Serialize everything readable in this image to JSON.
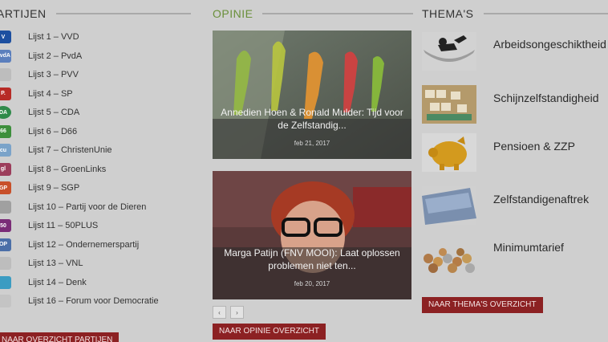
{
  "partijen": {
    "title": "ARTIJEN",
    "items": [
      {
        "label": "Lijst 1 – VVD",
        "logo_text": "V",
        "logo_color": "#1d4fa0",
        "icon": "vvd-logo-icon"
      },
      {
        "label": "Lijst 2 – PvdA",
        "logo_text": "PvdA",
        "logo_color": "#5b7fbd",
        "icon": "pvda-logo-icon"
      },
      {
        "label": "Lijst 3 – PVV",
        "logo_text": "",
        "logo_color": "#bdbdbd",
        "icon": "pvv-logo-icon"
      },
      {
        "label": "Lijst 4 – SP",
        "logo_text": "P.",
        "logo_color": "#b72b26",
        "icon": "sp-logo-icon"
      },
      {
        "label": "Lijst 5 – CDA",
        "logo_text": "DA",
        "logo_color": "#2f8a4a",
        "icon": "cda-logo-icon"
      },
      {
        "label": "Lijst 6 – D66",
        "logo_text": "66",
        "logo_color": "#3d8f3c",
        "icon": "d66-logo-icon"
      },
      {
        "label": "Lijst 7 – ChristenUnie",
        "logo_text": "cu",
        "logo_color": "#7aa3c9",
        "icon": "christenunie-logo-icon"
      },
      {
        "label": "Lijst 8 – GroenLinks",
        "logo_text": "gl",
        "logo_color": "#9c3d5b",
        "icon": "groenlinks-logo-icon"
      },
      {
        "label": "Lijst 9 – SGP",
        "logo_text": "GP",
        "logo_color": "#c8502a",
        "icon": "sgp-logo-icon"
      },
      {
        "label": "Lijst 10 – Partij voor de Dieren",
        "logo_text": "",
        "logo_color": "#a0a0a0",
        "icon": "pvdd-logo-icon"
      },
      {
        "label": "Lijst 11 – 50PLUS",
        "logo_text": "50",
        "logo_color": "#7a2c77",
        "icon": "50plus-logo-icon"
      },
      {
        "label": "Lijst 12 – Ondernemerspartij",
        "logo_text": "OP",
        "logo_color": "#4b6fa8",
        "icon": "ondernemerspartij-logo-icon"
      },
      {
        "label": "Lijst 13 – VNL",
        "logo_text": "",
        "logo_color": "#bdbdbd",
        "icon": "vnl-logo-icon"
      },
      {
        "label": "Lijst 14 – Denk",
        "logo_text": "",
        "logo_color": "#3b9cc2",
        "icon": "denk-logo-icon"
      },
      {
        "label": "Lijst 16 – Forum voor Democratie",
        "logo_text": "",
        "logo_color": "#c4c4c4",
        "icon": "fvd-logo-icon"
      }
    ],
    "button": "NAAR OVERZICHT PARTIJEN"
  },
  "opinie": {
    "title": "OPINIE",
    "articles": [
      {
        "title": "Annedien Hoen & Ronald Mulder: Tijd voor de Zelfstandig...",
        "date": "feb 21, 2017"
      },
      {
        "title": "Marga Patijn (FNV MOOI): Laat oplossen problemen niet ten...",
        "date": "feb 20, 2017"
      }
    ],
    "pager": {
      "prev": "‹",
      "next": "›"
    },
    "button": "NAAR OPINIE OVERZICHT"
  },
  "themas": {
    "title": "THEMA'S",
    "items": [
      {
        "label": "Arbeidsongeschiktheid"
      },
      {
        "label": "Schijnzelfstandigheid"
      },
      {
        "label": "Pensioen & ZZP"
      },
      {
        "label": "Zelfstandigenaftrek"
      },
      {
        "label": "Minimumtarief"
      }
    ],
    "button": "NAAR THEMA'S OVERZICHT"
  },
  "colors": {
    "accent_red": "#8c2123",
    "opinie_green": "#6a8f3a"
  }
}
